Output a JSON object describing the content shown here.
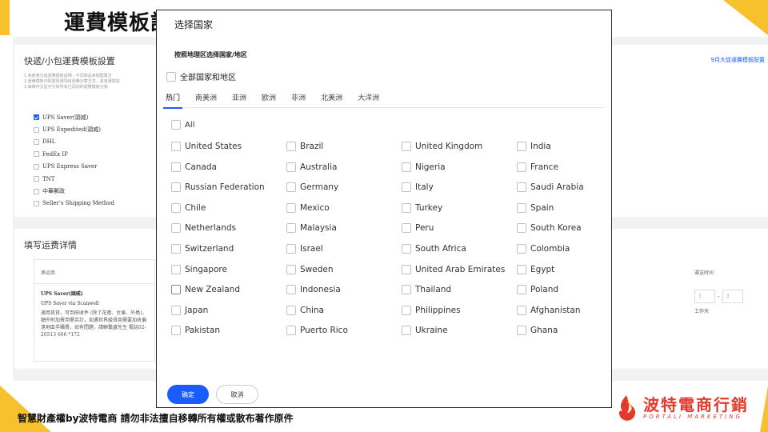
{
  "slide": {
    "title": "運費模板設",
    "footer": "智慧財產權by波特電商 請勿非法擅自移轉所有權或散布著作原件",
    "logo_cn": "波特電商行銷",
    "logo_en": "PORTALI MARKETING"
  },
  "background": {
    "card1_title": "快遞/小包運費模板設置",
    "card1_notes": [
      "1.系統會生成運費模板說明，不同商品會按配置方",
      "2.運費模板中配置所選項目運費計算方式，買家選擇該",
      "3.每條中文區可分析所有已添加的運費模板分為"
    ],
    "card1_link": "9月大促運費模板配置",
    "carriers": [
      {
        "name": "UPS Saver(頭威)",
        "checked": true
      },
      {
        "name": "UPS Expedited(頭威)",
        "checked": false
      },
      {
        "name": "DHL",
        "checked": false
      },
      {
        "name": "FedEx IP",
        "checked": false
      },
      {
        "name": "UPS Express Saver",
        "checked": false
      },
      {
        "name": "TNT",
        "checked": false
      },
      {
        "name": "中華郵政",
        "checked": false
      },
      {
        "name": "Seller's Shipping Method",
        "checked": false
      }
    ],
    "card2_title": "填写运费详情",
    "fee_table_header": "承运商",
    "fee_carrier": "UPS Saver(頭威)",
    "fee_service": "UPS Saver via Scanwell",
    "fee_desc": "適用貨貨，可到府收件 (除了花蓮、台東、外島)，額外附加費用需另計，如遇世界級貨商需要加收偏遠地區手續費，如有問題，請聯繫盧先生 電話02-26513 666 *172",
    "time_header": "運送时间",
    "time_from": "3",
    "time_to": "3",
    "time_sep": "-",
    "time_unit": "工作天"
  },
  "modal": {
    "title": "选择国家",
    "subtitle": "按照地理区选择国家/地区",
    "select_all": "全部国家和地区",
    "tabs": [
      "热门",
      "南美洲",
      "亚洲",
      "欧洲",
      "非洲",
      "北美洲",
      "大洋洲"
    ],
    "all_label": "All",
    "countries": [
      "United States",
      "Brazil",
      "United Kingdom",
      "India",
      "Canada",
      "Australia",
      "Nigeria",
      "France",
      "Russian Federation",
      "Germany",
      "Italy",
      "Saudi Arabia",
      "Chile",
      "Mexico",
      "Turkey",
      "Spain",
      "Netherlands",
      "Malaysia",
      "Peru",
      "South Korea",
      "Switzerland",
      "Israel",
      "South Africa",
      "Colombia",
      "Singapore",
      "Sweden",
      "United Arab Emirates",
      "Egypt",
      "New Zealand",
      "Indonesia",
      "Thailand",
      "Poland",
      "Japan",
      "China",
      "Philippines",
      "Afghanistan",
      "Pakistan",
      "Puerto Rico",
      "Ukraine",
      "Ghana"
    ],
    "ok_label": "确定",
    "cancel_label": "取消"
  },
  "colors": {
    "accent": "#1a5cff",
    "brand_yellow": "#f7c12e",
    "logo_red": "#e23b2e"
  }
}
